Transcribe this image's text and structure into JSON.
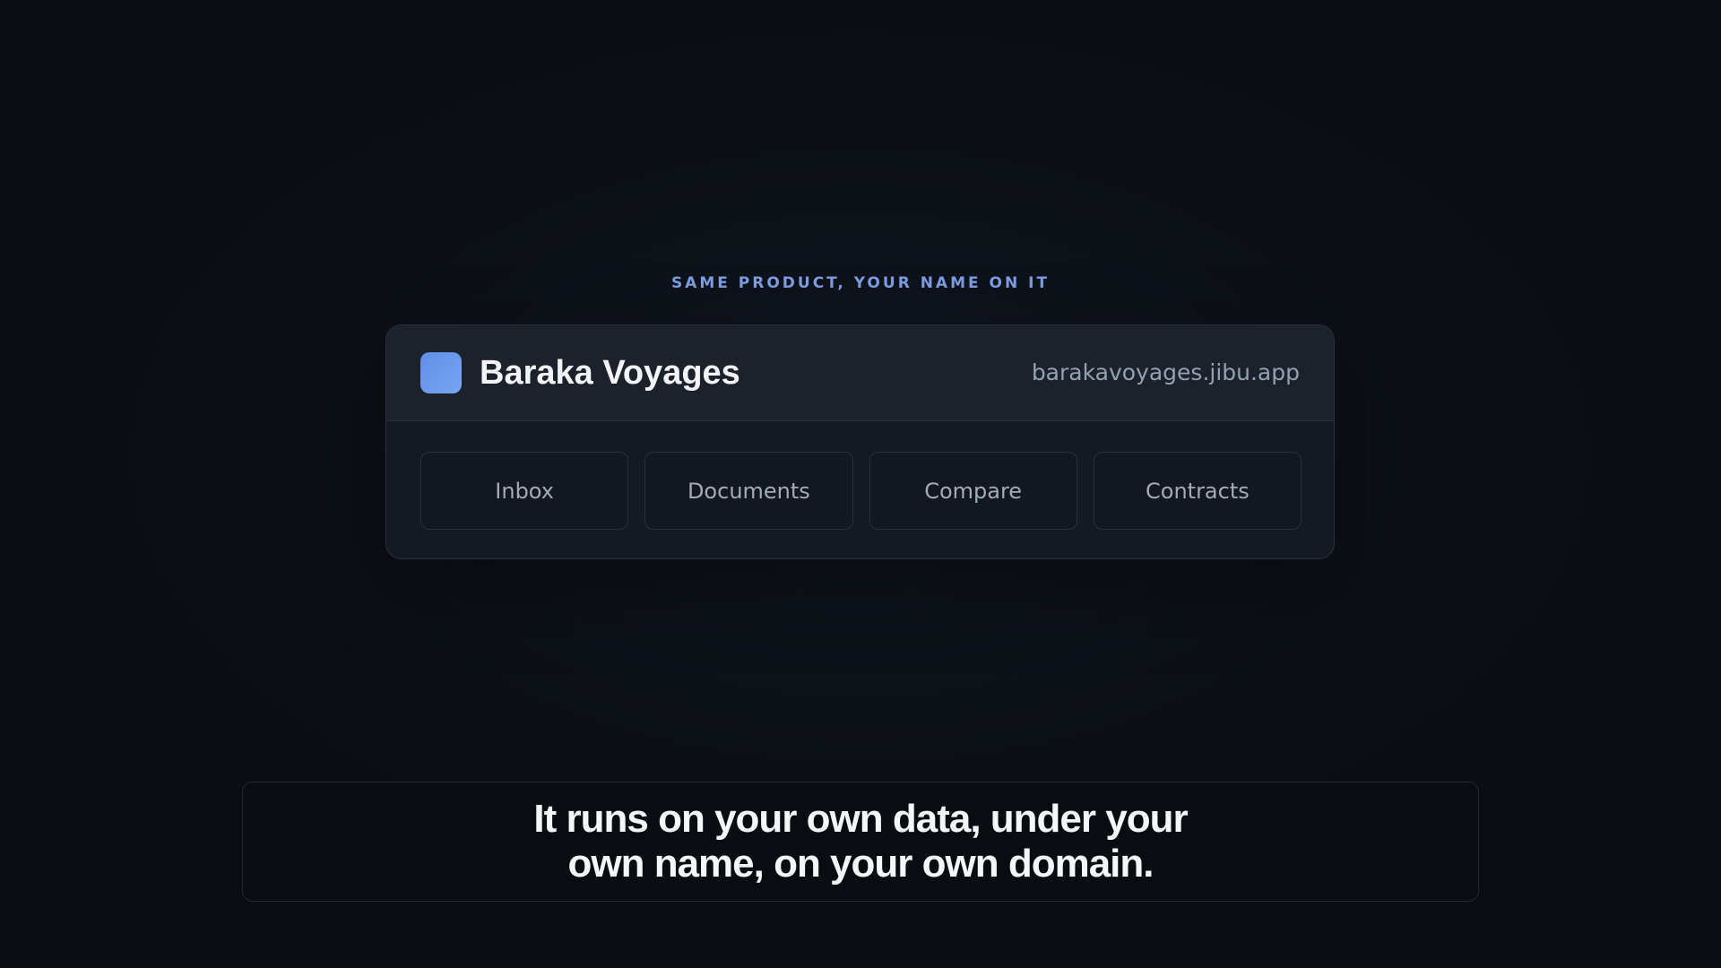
{
  "eyebrow": "SAME PRODUCT, YOUR NAME ON IT",
  "card": {
    "brand_name": "Baraka Voyages",
    "domain": "barakavoyages.jibu.app",
    "nav": [
      "Inbox",
      "Documents",
      "Compare",
      "Contracts"
    ]
  },
  "caption": "It runs on your own data, under your own name, on your own domain.",
  "colors": {
    "accent": "#7d9ee3",
    "logo": "#6b9bee",
    "background": "#0d1118"
  },
  "icons": {
    "logo": "brand-logo-square"
  }
}
